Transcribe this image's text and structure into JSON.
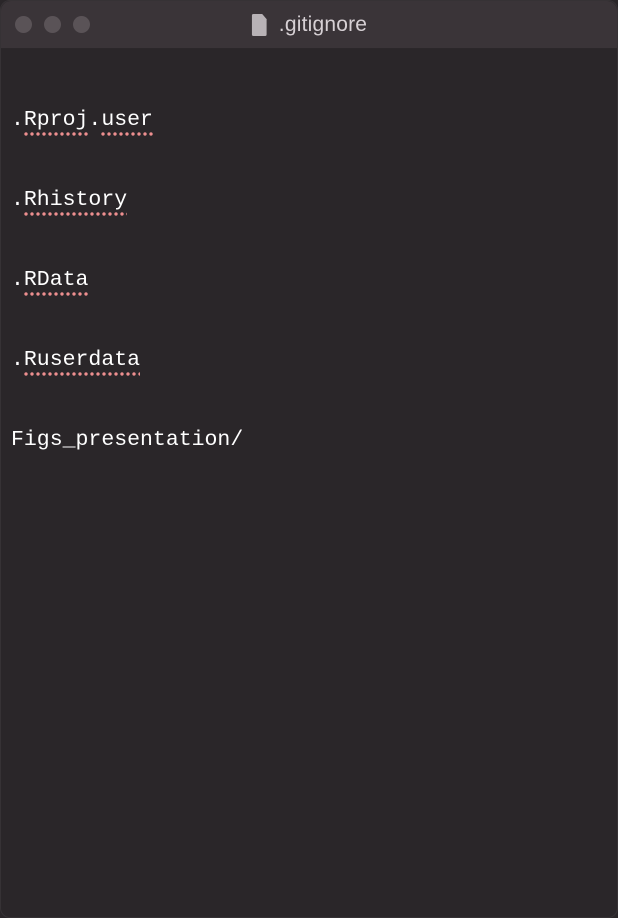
{
  "window": {
    "title": ".gitignore",
    "file_icon_name": "file-icon"
  },
  "editor": {
    "lines": [
      {
        "prefix": ".",
        "spell": "Rproj",
        "mid": ".",
        "spell2": "user",
        "suffix": ""
      },
      {
        "prefix": ".",
        "spell": "Rhistory",
        "mid": "",
        "spell2": "",
        "suffix": ""
      },
      {
        "prefix": ".",
        "spell": "RData",
        "mid": "",
        "spell2": "",
        "suffix": ""
      },
      {
        "prefix": ".",
        "spell": "Ruserdata",
        "mid": "",
        "spell2": "",
        "suffix": ""
      },
      {
        "prefix": "",
        "spell": "",
        "mid": "",
        "spell2": "",
        "suffix": "Figs_presentation/"
      }
    ]
  }
}
